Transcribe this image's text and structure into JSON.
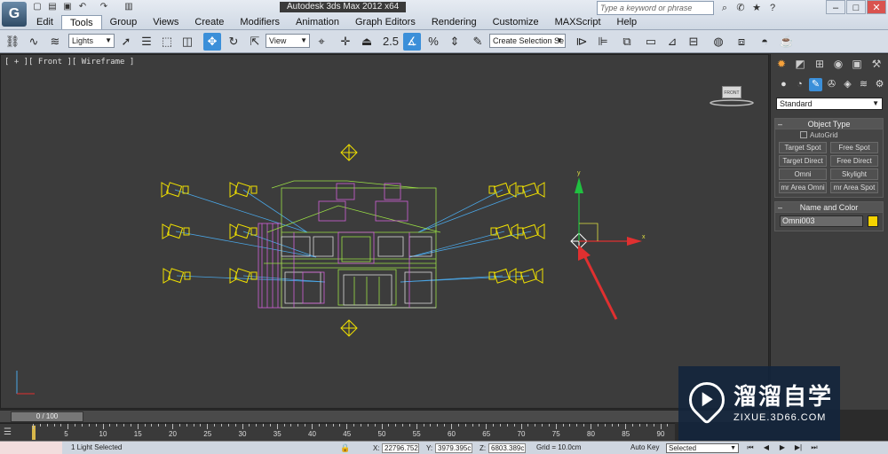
{
  "app": {
    "window_title": "Autodesk 3ds Max 2012 x64",
    "logo_letter": "G"
  },
  "menu": {
    "items": [
      "Edit",
      "Tools",
      "Group",
      "Views",
      "Create",
      "Modifiers",
      "Animation",
      "Graph Editors",
      "Rendering",
      "Customize",
      "MAXScript",
      "Help"
    ],
    "active": "Tools"
  },
  "search": {
    "placeholder": "Type a keyword or phrase"
  },
  "toolbar": {
    "selection_filter": "Lights",
    "reference_coord": "View",
    "named_selection_set": "Create Selection Se",
    "snap_angle_label": "2.5",
    "percent_snap_label": "%"
  },
  "viewport": {
    "label": "[ + ][ Front ][ Wireframe ]",
    "viewcube_label": "FRONT",
    "gizmo_x_label": "x",
    "gizmo_y_label": "y"
  },
  "command_panel": {
    "category_dropdown": "Standard",
    "object_type": {
      "title": "Object Type",
      "autogrid_label": "AutoGrid",
      "buttons": [
        "Target Spot",
        "Free Spot",
        "Target Direct",
        "Free Direct",
        "Omni",
        "Skylight",
        "mr Area Omni",
        "mr Area Spot"
      ]
    },
    "name_and_color": {
      "title": "Name and Color",
      "name_value": "Omni003",
      "color": "#f5d300"
    }
  },
  "timeline": {
    "slider_label": "0 / 100",
    "current_frame": 0,
    "tick_labels": [
      "0",
      "5",
      "10",
      "15",
      "20",
      "25",
      "30",
      "35",
      "40",
      "45",
      "50",
      "55",
      "60",
      "65",
      "70",
      "75",
      "80",
      "85",
      "90"
    ]
  },
  "status": {
    "message": "1 Light Selected",
    "x_label": "X:",
    "x_value": "22796.752",
    "y_label": "Y:",
    "y_value": "3979.395c",
    "z_label": "Z:",
    "z_value": "6803.389c",
    "grid": "Grid = 10.0cm",
    "autokey_label": "Auto Key",
    "key_mode": "Selected"
  },
  "watermark": {
    "brand_cn": "溜溜自学",
    "url": "ZIXUE.3D66.COM"
  },
  "colors": {
    "viewport_bg": "#3c3c3c",
    "light_icon": "#f0e000",
    "light_target_line": "#4aa6e6",
    "house_wire_green": "#9adf45",
    "house_wire_magenta": "#d060d8",
    "arrow_red": "#e03030",
    "gizmo_green": "#20c040"
  }
}
